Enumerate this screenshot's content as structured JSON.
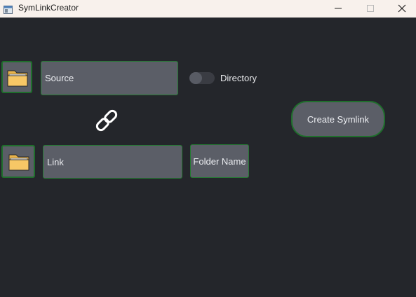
{
  "window": {
    "title": "SymLinkCreator",
    "app_icon": "window-app-icon",
    "controls": [
      "minimize-icon",
      "maximize-icon",
      "close-icon"
    ]
  },
  "source_row": {
    "browse_icon": "folder-icon",
    "input_placeholder": "Source",
    "toggle_label": "Directory",
    "toggle_on": false
  },
  "link_icon": "chain-link-icon",
  "link_row": {
    "browse_icon": "folder-icon",
    "input_placeholder": "Link",
    "folder_name_label": "Folder Name"
  },
  "create_button_label": "Create Symlink",
  "colors": {
    "background": "#24262b",
    "control": "#5b5e67",
    "accent_border": "#1f6f2c",
    "titlebar": "#f8f1ec",
    "folder": "#f7c766"
  }
}
